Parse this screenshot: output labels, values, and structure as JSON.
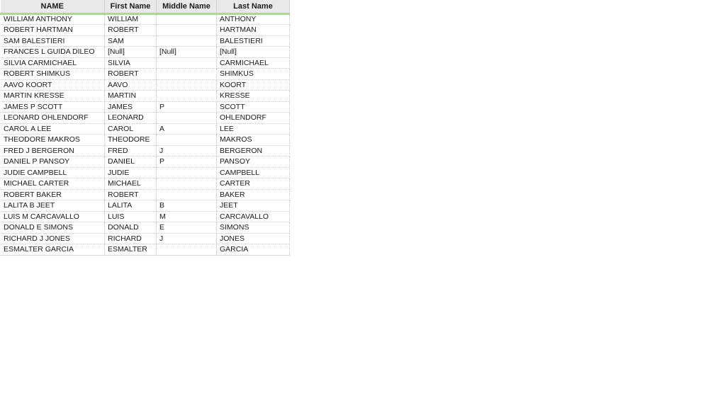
{
  "grid": {
    "columns": [
      {
        "key": "name",
        "label": "NAME"
      },
      {
        "key": "first",
        "label": "First Name"
      },
      {
        "key": "middle",
        "label": "Middle Name"
      },
      {
        "key": "last",
        "label": "Last Name"
      }
    ],
    "null_token": "[Null]",
    "accent_color": "#aed694",
    "header_background": "#e9e9e9",
    "header_text_color": "#1b1b1b",
    "cell_text_color": "#1b1b1b",
    "null_text_color": "#a6a6a6",
    "row_count": 22,
    "rows": [
      {
        "name": "WILLIAM ANTHONY",
        "first": "WILLIAM",
        "middle": "",
        "last": "ANTHONY"
      },
      {
        "name": "ROBERT HARTMAN",
        "first": "ROBERT",
        "middle": "",
        "last": "HARTMAN"
      },
      {
        "name": "SAM BALESTIERI",
        "first": "SAM",
        "middle": "",
        "last": "BALESTIERI"
      },
      {
        "name": "FRANCES L GUIDA DILEO",
        "first": "[Null]",
        "middle": "[Null]",
        "last": "[Null]"
      },
      {
        "name": "SILVIA CARMICHAEL",
        "first": "SILVIA",
        "middle": "",
        "last": "CARMICHAEL"
      },
      {
        "name": "ROBERT SHIMKUS",
        "first": "ROBERT",
        "middle": "",
        "last": "SHIMKUS"
      },
      {
        "name": "AAVO KOORT",
        "first": "AAVO",
        "middle": "",
        "last": "KOORT"
      },
      {
        "name": "MARTIN KRESSE",
        "first": "MARTIN",
        "middle": "",
        "last": "KRESSE"
      },
      {
        "name": "JAMES P SCOTT",
        "first": "JAMES",
        "middle": "P",
        "last": "SCOTT"
      },
      {
        "name": "LEONARD OHLENDORF",
        "first": "LEONARD",
        "middle": "",
        "last": "OHLENDORF"
      },
      {
        "name": "CAROL A LEE",
        "first": "CAROL",
        "middle": "A",
        "last": "LEE"
      },
      {
        "name": "THEODORE MAKROS",
        "first": "THEODORE",
        "middle": "",
        "last": "MAKROS"
      },
      {
        "name": "FRED J BERGERON",
        "first": "FRED",
        "middle": "J",
        "last": "BERGERON"
      },
      {
        "name": "DANIEL P PANSOY",
        "first": "DANIEL",
        "middle": "P",
        "last": "PANSOY"
      },
      {
        "name": "JUDIE CAMPBELL",
        "first": "JUDIE",
        "middle": "",
        "last": "CAMPBELL"
      },
      {
        "name": "MICHAEL CARTER",
        "first": "MICHAEL",
        "middle": "",
        "last": "CARTER"
      },
      {
        "name": "ROBERT BAKER",
        "first": "ROBERT",
        "middle": "",
        "last": "BAKER"
      },
      {
        "name": "LALITA B JEET",
        "first": "LALITA",
        "middle": "B",
        "last": "JEET"
      },
      {
        "name": "LUIS M CARCAVALLO",
        "first": "LUIS",
        "middle": "M",
        "last": "CARCAVALLO"
      },
      {
        "name": "DONALD E SIMONS",
        "first": "DONALD",
        "middle": "E",
        "last": "SIMONS"
      },
      {
        "name": "RICHARD J JONES",
        "first": "RICHARD",
        "middle": "J",
        "last": "JONES"
      },
      {
        "name": "ESMALTER GARCIA",
        "first": "ESMALTER",
        "middle": "",
        "last": "GARCIA"
      }
    ]
  }
}
